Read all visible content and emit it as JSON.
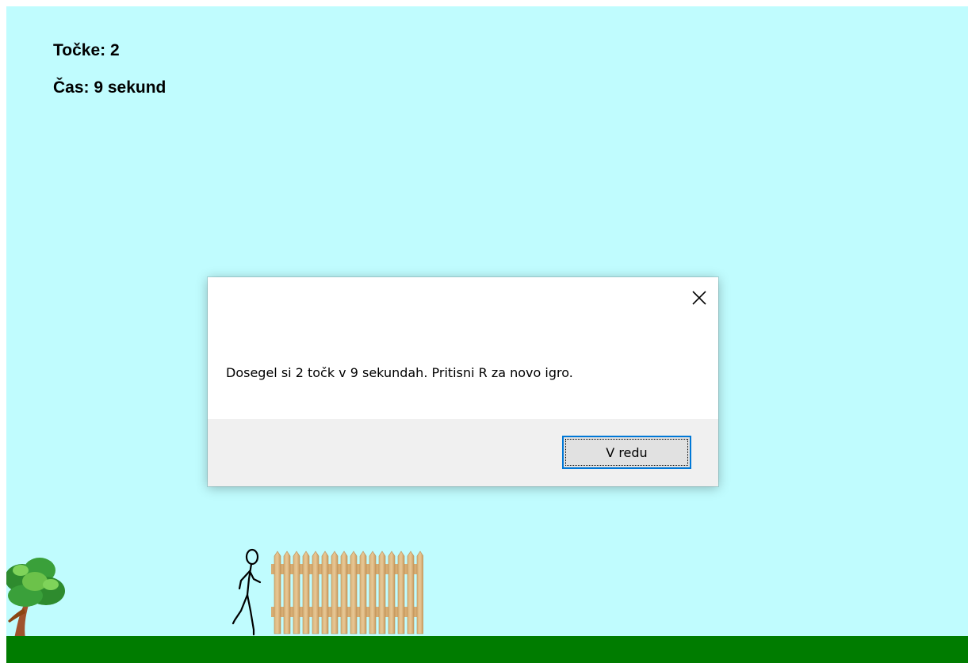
{
  "hud": {
    "score_text": "Točke: 2",
    "time_text": "Čas: 9 sekund"
  },
  "dialog": {
    "message": "Dosegel si 2 točk v 9 sekundah. Pritisni R za novo igro.",
    "ok_label": "V redu",
    "close_icon": "close-icon"
  },
  "scene": {
    "sky_color": "#c0fcfe",
    "ground_color": "#007c00",
    "sprites": [
      "tree",
      "stickman",
      "fence"
    ]
  }
}
